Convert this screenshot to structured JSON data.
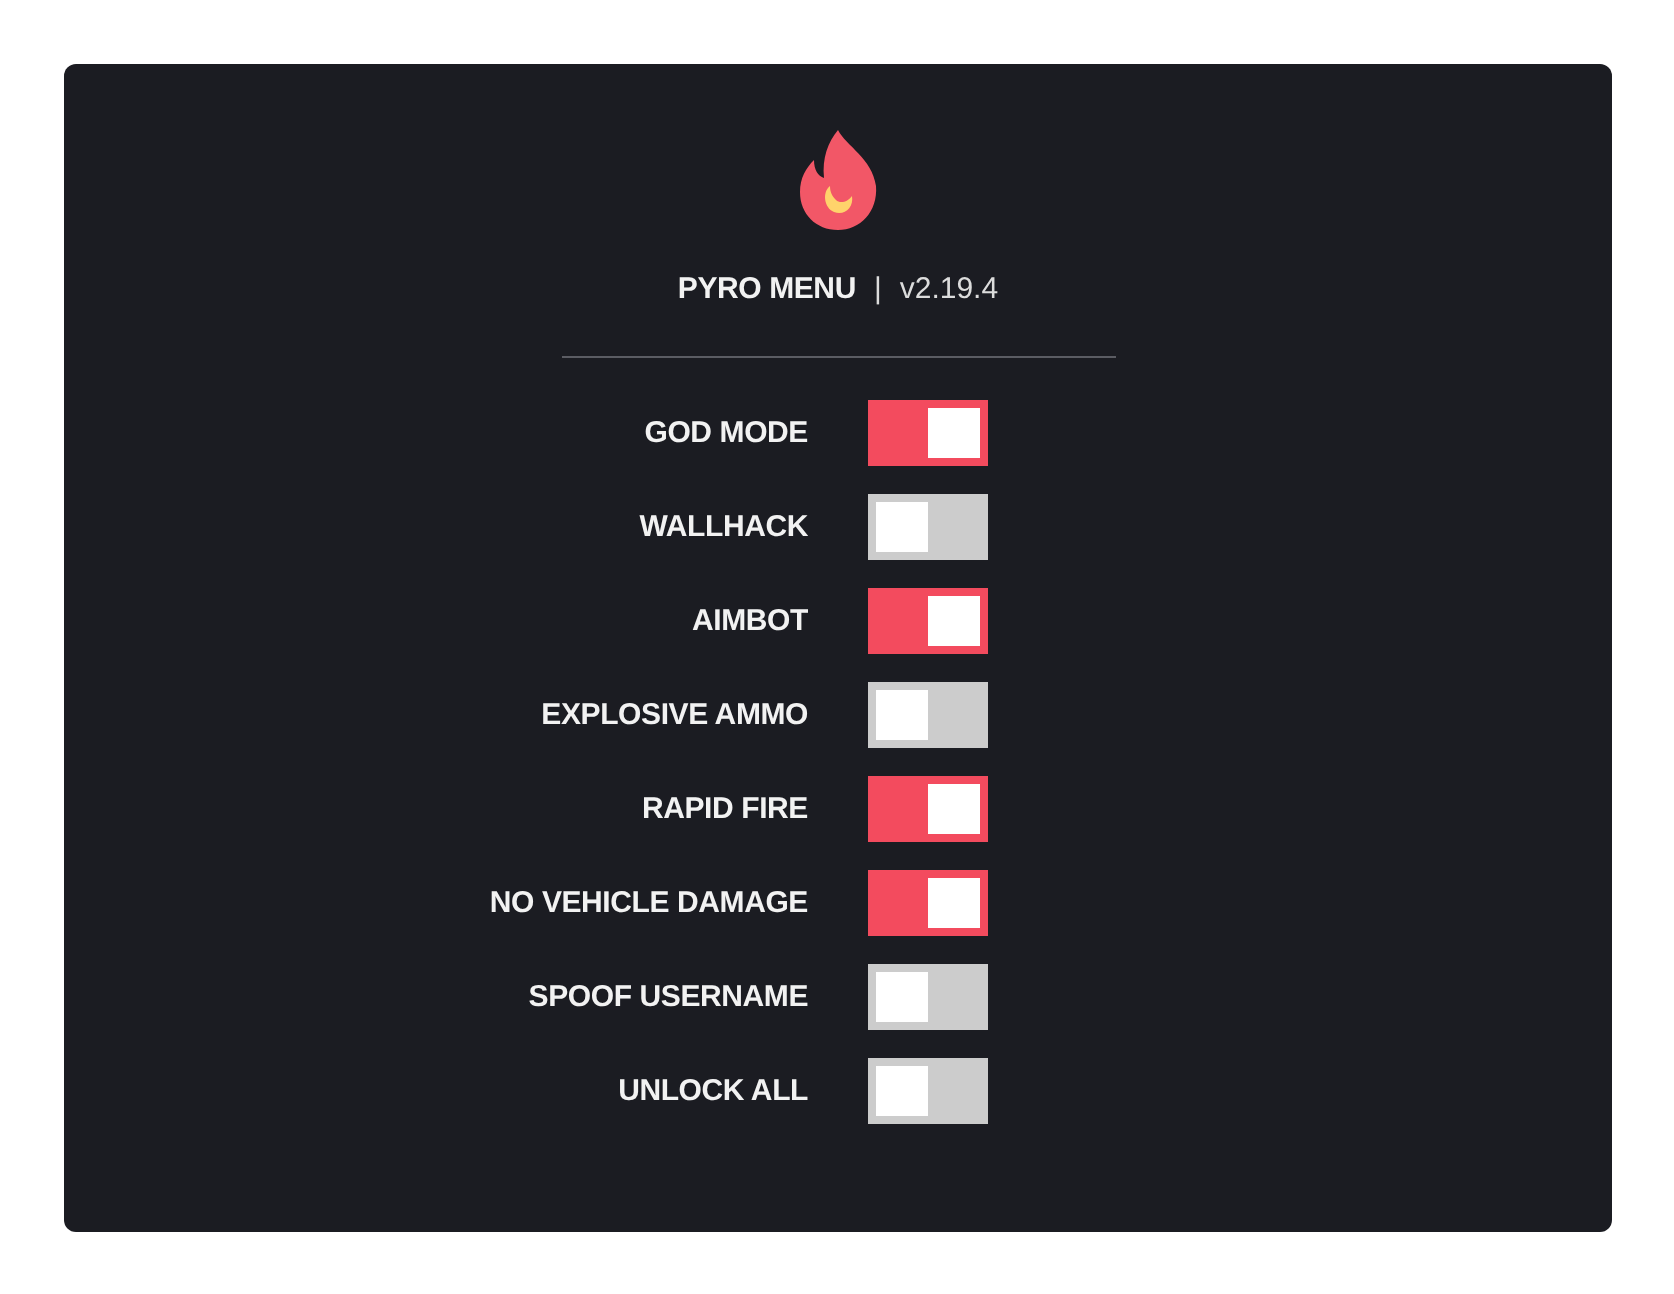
{
  "header": {
    "title": "PYRO MENU",
    "separator": "|",
    "version": "v2.19.4"
  },
  "options": [
    {
      "label": "GOD MODE",
      "on": true
    },
    {
      "label": "WALLHACK",
      "on": false
    },
    {
      "label": "AIMBOT",
      "on": true
    },
    {
      "label": "EXPLOSIVE AMMO",
      "on": false
    },
    {
      "label": "RAPID FIRE",
      "on": true
    },
    {
      "label": "NO VEHICLE DAMAGE",
      "on": true
    },
    {
      "label": "SPOOF USERNAME",
      "on": false
    },
    {
      "label": "UNLOCK ALL",
      "on": false
    }
  ]
}
